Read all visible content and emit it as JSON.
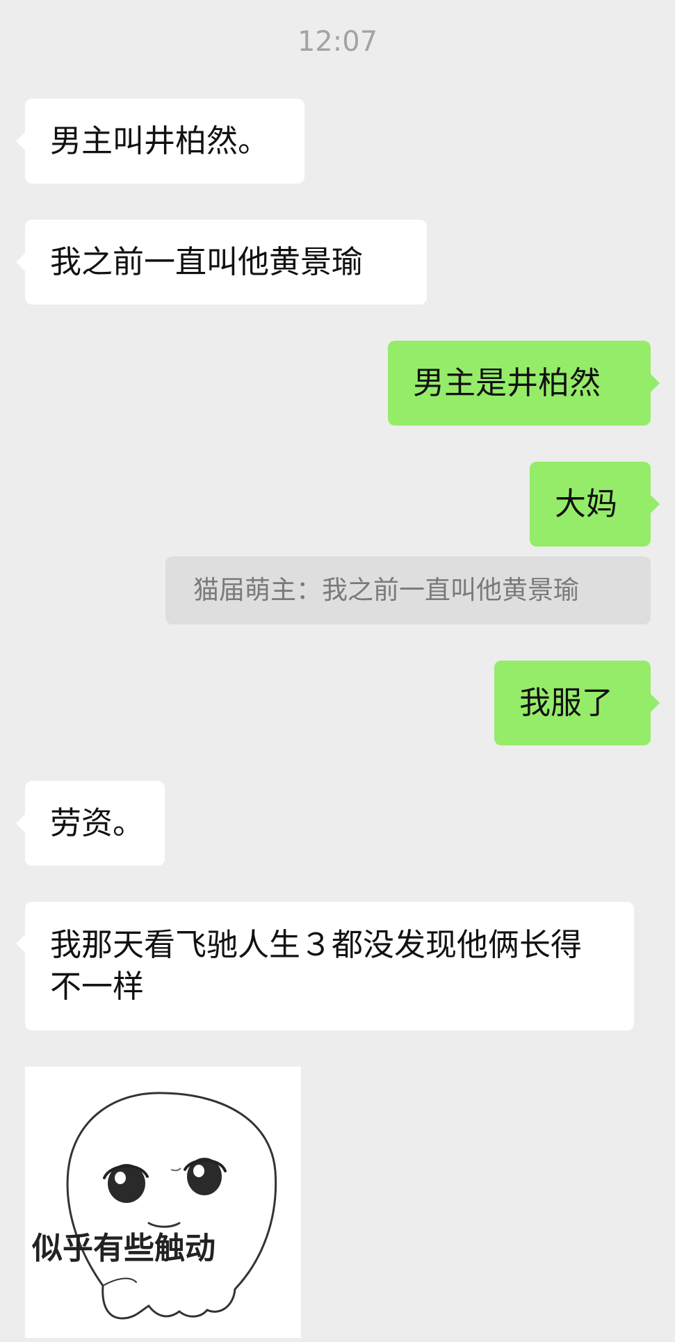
{
  "chat": {
    "timestamp": "12:07",
    "messages": [
      {
        "side": "left",
        "text": "男主叫井柏然。"
      },
      {
        "side": "left",
        "text": "我之前一直叫他黄景瑜"
      },
      {
        "side": "right",
        "text": "男主是井柏然"
      },
      {
        "side": "right",
        "text": "大妈"
      },
      {
        "side": "right",
        "type": "quote",
        "text": "猫届萌主：我之前一直叫他黄景瑜"
      },
      {
        "side": "right",
        "text": "我服了"
      },
      {
        "side": "left",
        "text": "劳资。"
      },
      {
        "side": "left",
        "text": "我那天看飞驰人生３都没发现他俩长得不一样"
      },
      {
        "side": "left",
        "type": "sticker",
        "icon": "ghost-sticker-icon",
        "caption": "似乎有些触动"
      }
    ]
  },
  "colors": {
    "background": "#ededed",
    "bubble_left": "#ffffff",
    "bubble_right": "#95ec69",
    "quote_background": "#dedede",
    "timestamp_text": "#a3a3a3"
  }
}
